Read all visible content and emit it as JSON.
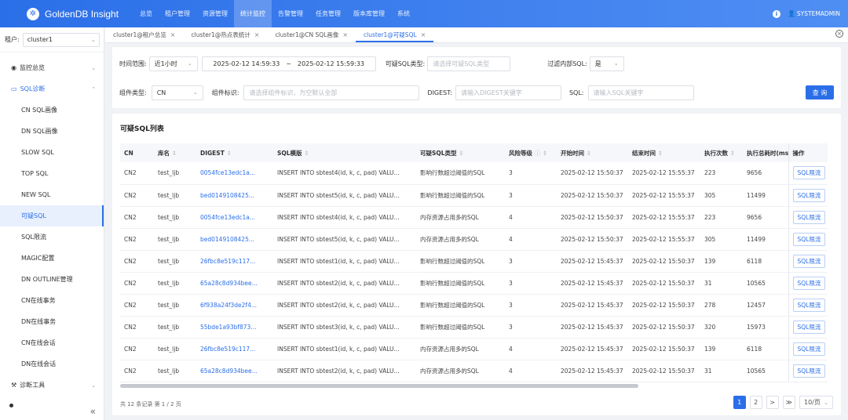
{
  "app": {
    "title": "GoldenDB Insight",
    "user": "SYSTEMADMIN"
  },
  "nav": [
    "总览",
    "租户管理",
    "资源管理",
    "统计监控",
    "告警管理",
    "任务管理",
    "版本库管理",
    "系统"
  ],
  "nav_active": "统计监控",
  "tenant": {
    "label": "租户:",
    "value": "cluster1"
  },
  "sidebar": {
    "group1": "监控总览",
    "group2": "SQL诊断",
    "items": [
      "CN SQL画像",
      "DN SQL画像",
      "SLOW SQL",
      "TOP SQL",
      "NEW SQL",
      "可疑SQL",
      "SQL限流",
      "MAGIC配置",
      "DN OUTLINE管理",
      "CN在线事务",
      "DN在线事务",
      "CN在线会话",
      "DN在线会话"
    ],
    "active_item": "可疑SQL",
    "group3": "诊断工具",
    "collapse": "«"
  },
  "tabs": [
    {
      "label": "cluster1@租户总览",
      "active": false
    },
    {
      "label": "cluster1@热点表统计",
      "active": false
    },
    {
      "label": "cluster1@CN SQL画像",
      "active": false
    },
    {
      "label": "cluster1@可疑SQL",
      "active": true
    }
  ],
  "filter": {
    "time_label": "时间范围:",
    "time_preset": "近1小时",
    "time_start": "2025-02-12 14:59:33",
    "time_sep": "~",
    "time_end": "2025-02-12 15:59:33",
    "suspect_type_label": "可疑SQL类型:",
    "suspect_type_placeholder": "请选择可疑SQL类型",
    "internal_label": "过滤内部SQL:",
    "internal_value": "是",
    "comp_type_label": "组件类型:",
    "comp_type_value": "CN",
    "comp_id_label": "组件标识:",
    "comp_id_placeholder": "请选择组件标识，为空默认全部",
    "digest_label": "DIGEST:",
    "digest_placeholder": "请输入DIGEST关键字",
    "sql_label": "SQL:",
    "sql_placeholder": "请输入SQL关键字",
    "query_button": "查 询"
  },
  "table": {
    "title": "可疑SQL列表",
    "columns": [
      "CN",
      "库名",
      "DIGEST",
      "SQL模版",
      "可疑SQL类型",
      "风险等级",
      "开始时间",
      "结束时间",
      "执行次数",
      "执行总耗时(ms",
      "操作"
    ],
    "rows": [
      [
        "CN2",
        "test_ljb",
        "0054fce13edc1a...",
        "INSERT INTO sbtest4(id, k, c, pad) VALU...",
        "影响行数超过阈值的SQL",
        "3",
        "2025-02-12 15:50:37",
        "2025-02-12 15:55:37",
        "223",
        "9656"
      ],
      [
        "CN2",
        "test_ljb",
        "bed0149108425...",
        "INSERT INTO sbtest5(id, k, c, pad) VALU...",
        "影响行数超过阈值的SQL",
        "3",
        "2025-02-12 15:50:37",
        "2025-02-12 15:55:37",
        "305",
        "11499"
      ],
      [
        "CN2",
        "test_ljb",
        "0054fce13edc1a...",
        "INSERT INTO sbtest4(id, k, c, pad) VALU...",
        "内存资源占用多的SQL",
        "4",
        "2025-02-12 15:50:37",
        "2025-02-12 15:55:37",
        "223",
        "9656"
      ],
      [
        "CN2",
        "test_ljb",
        "bed0149108425...",
        "INSERT INTO sbtest5(id, k, c, pad) VALU...",
        "内存资源占用多的SQL",
        "4",
        "2025-02-12 15:50:37",
        "2025-02-12 15:55:37",
        "305",
        "11499"
      ],
      [
        "CN2",
        "test_ljb",
        "26fbc8e519c117...",
        "INSERT INTO sbtest1(id, k, c, pad) VALU...",
        "影响行数超过阈值的SQL",
        "3",
        "2025-02-12 15:45:37",
        "2025-02-12 15:50:37",
        "139",
        "6118"
      ],
      [
        "CN2",
        "test_ljb",
        "65a28c8d934bee...",
        "INSERT INTO sbtest2(id, k, c, pad) VALU...",
        "影响行数超过阈值的SQL",
        "3",
        "2025-02-12 15:45:37",
        "2025-02-12 15:50:37",
        "31",
        "10565"
      ],
      [
        "CN2",
        "test_ljb",
        "6f938a24f3de2f4...",
        "INSERT INTO sbtest2(id, k, c, pad) VALU...",
        "影响行数超过阈值的SQL",
        "3",
        "2025-02-12 15:45:37",
        "2025-02-12 15:50:37",
        "278",
        "12457"
      ],
      [
        "CN2",
        "test_ljb",
        "55bde1a93bf873...",
        "INSERT INTO sbtest3(id, k, c, pad) VALU...",
        "影响行数超过阈值的SQL",
        "3",
        "2025-02-12 15:45:37",
        "2025-02-12 15:50:37",
        "320",
        "15973"
      ],
      [
        "CN2",
        "test_ljb",
        "26fbc8e519c117...",
        "INSERT INTO sbtest1(id, k, c, pad) VALU...",
        "内存资源占用多的SQL",
        "4",
        "2025-02-12 15:45:37",
        "2025-02-12 15:50:37",
        "139",
        "6118"
      ],
      [
        "CN2",
        "test_ljb",
        "65a28c8d934bee...",
        "INSERT INTO sbtest2(id, k, c, pad) VALU...",
        "内存资源占用多的SQL",
        "4",
        "2025-02-12 15:45:37",
        "2025-02-12 15:50:37",
        "31",
        "10565"
      ]
    ],
    "action_label": "SQL限流"
  },
  "pagination": {
    "summary": "共 12 条记录  第 1 / 2 页",
    "pages": [
      "1",
      "2"
    ],
    "current": "1",
    "next": ">",
    "last": "≫",
    "page_size": "10/页"
  },
  "colors": {
    "accent": "#2b6fe8",
    "header_gradient_end": "#4f8ef3"
  }
}
